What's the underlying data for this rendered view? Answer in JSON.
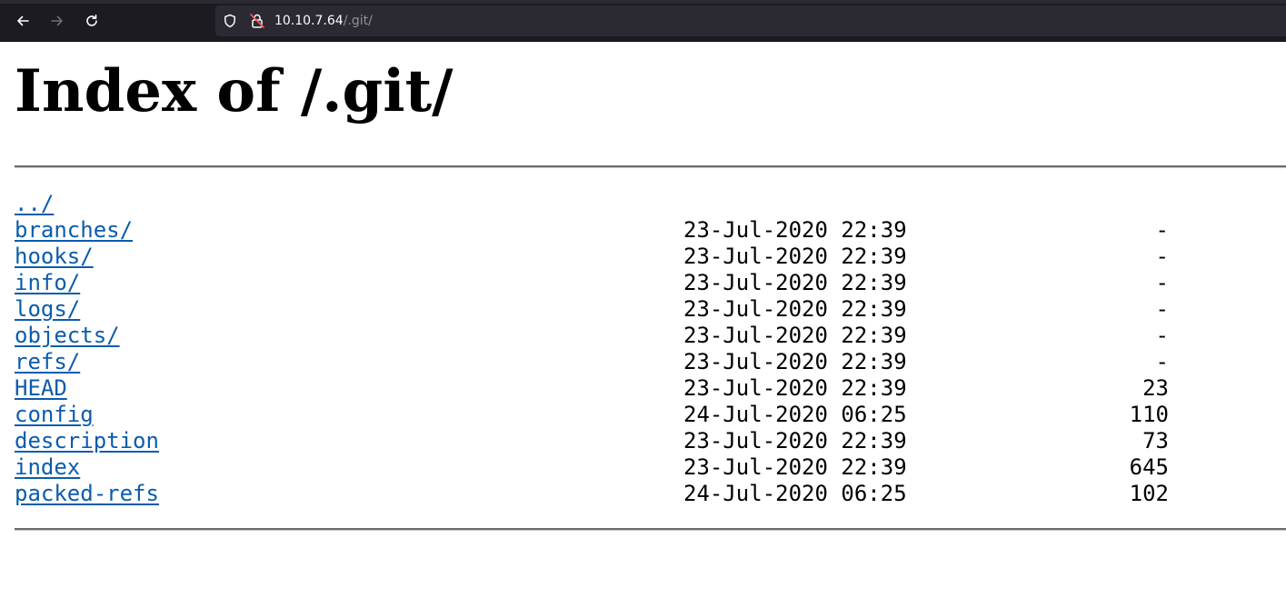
{
  "browser": {
    "url_host": "10.10.7.64",
    "url_path": "/.git/"
  },
  "page": {
    "title": "Index of /.git/",
    "parent_link": "../",
    "entries": [
      {
        "name": "branches/",
        "date": "23-Jul-2020 22:39",
        "size": "-"
      },
      {
        "name": "hooks/",
        "date": "23-Jul-2020 22:39",
        "size": "-"
      },
      {
        "name": "info/",
        "date": "23-Jul-2020 22:39",
        "size": "-"
      },
      {
        "name": "logs/",
        "date": "23-Jul-2020 22:39",
        "size": "-"
      },
      {
        "name": "objects/",
        "date": "23-Jul-2020 22:39",
        "size": "-"
      },
      {
        "name": "refs/",
        "date": "23-Jul-2020 22:39",
        "size": "-"
      },
      {
        "name": "HEAD",
        "date": "23-Jul-2020 22:39",
        "size": "23"
      },
      {
        "name": "config",
        "date": "24-Jul-2020 06:25",
        "size": "110"
      },
      {
        "name": "description",
        "date": "23-Jul-2020 22:39",
        "size": "73"
      },
      {
        "name": "index",
        "date": "23-Jul-2020 22:39",
        "size": "645"
      },
      {
        "name": "packed-refs",
        "date": "24-Jul-2020 06:25",
        "size": "102"
      }
    ]
  },
  "colors": {
    "link": "#0b5cad",
    "toolbar": "#1c1b22",
    "urlbar": "#2b2a33"
  }
}
